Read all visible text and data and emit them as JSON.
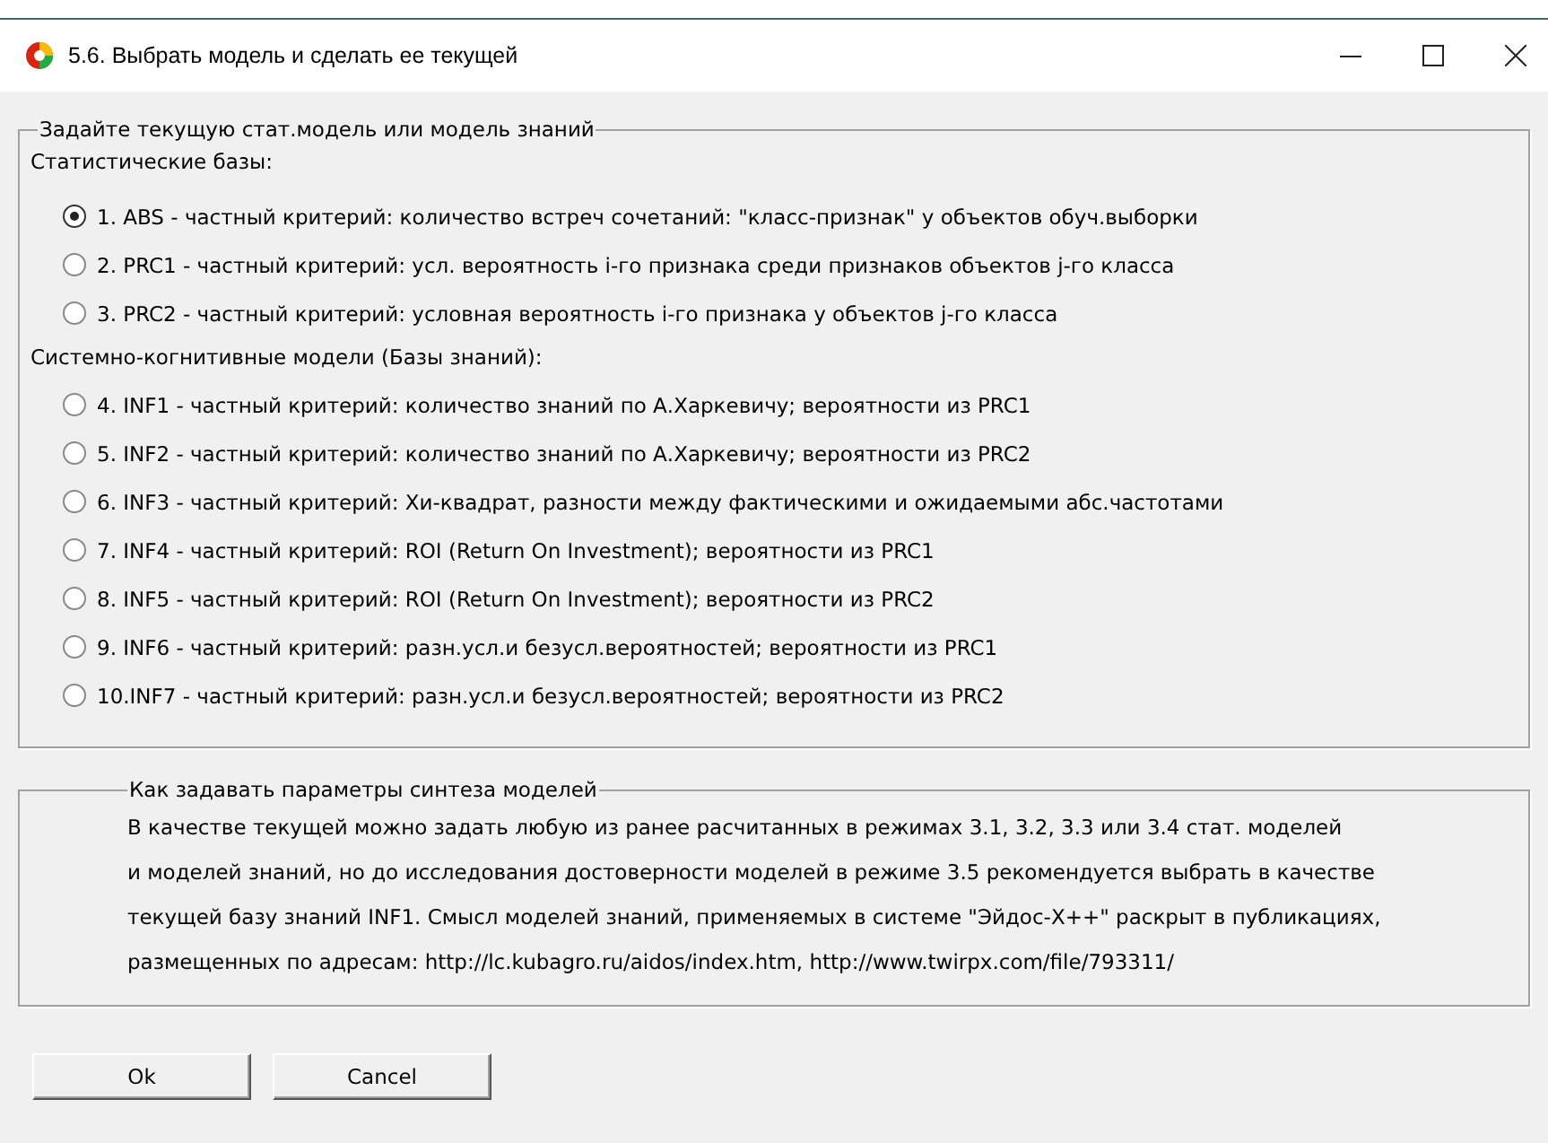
{
  "window": {
    "title": "5.6. Выбрать модель и сделать ее текущей"
  },
  "model_group": {
    "legend": "Задайте текущую стат.модель или модель знаний",
    "sections": [
      {
        "heading": "Статистические базы:",
        "options": [
          {
            "label": "1. ABS  - частный критерий: количество встреч сочетаний: \"класс-признак\" у объектов обуч.выборки",
            "selected": true
          },
          {
            "label": "2. PRC1 - частный критерий: усл. вероятность i-го признака среди признаков объектов j-го класса",
            "selected": false
          },
          {
            "label": "3. PRC2 - частный критерий: условная вероятность i-го признака у объектов j-го класса",
            "selected": false
          }
        ]
      },
      {
        "heading": "Системно-когнитивные модели (Базы знаний):",
        "options": [
          {
            "label": "4. INF1 - частный критерий: количество знаний по А.Харкевичу; вероятности из PRC1",
            "selected": false
          },
          {
            "label": "5. INF2 - частный критерий: количество знаний по А.Харкевичу; вероятности из PRC2",
            "selected": false
          },
          {
            "label": "6. INF3 - частный критерий: Хи-квадрат, разности между фактическими и ожидаемыми абс.частотами",
            "selected": false
          },
          {
            "label": "7. INF4 - частный критерий: ROI (Return On Investment); вероятности из PRC1",
            "selected": false
          },
          {
            "label": "8. INF5 - частный критерий: ROI (Return On Investment); вероятности из PRC2",
            "selected": false
          },
          {
            "label": "9. INF6 - частный критерий: разн.усл.и безусл.вероятностей; вероятности из PRC1",
            "selected": false
          },
          {
            "label": "10.INF7 - частный критерий: разн.усл.и безусл.вероятностей; вероятности из PRC2",
            "selected": false
          }
        ]
      }
    ]
  },
  "help_group": {
    "legend": "Как задавать параметры синтеза моделей",
    "lines": [
      "В качестве текущей можно задать любую из ранее расчитанных в режимах 3.1, 3.2, 3.3 или 3.4 стат. моделей",
      "и моделей знаний, но до исследования достоверности моделей в режиме 3.5 рекомендуется выбрать в качестве",
      "текущей базу знаний INF1. Смысл моделей знаний, применяемых в системе \"Эйдос-Х++\" раскрыт в публикациях,",
      "размещенных по адресам: http://lc.kubagro.ru/aidos/index.htm, http://www.twirpx.com/file/793311/"
    ]
  },
  "buttons": [
    "Ok",
    "Cancel"
  ]
}
